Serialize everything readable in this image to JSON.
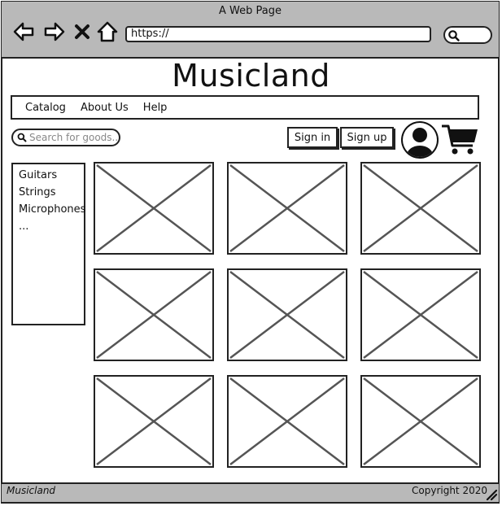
{
  "window": {
    "title": "A Web Page"
  },
  "browser": {
    "url": "https://"
  },
  "site": {
    "brand": "Musicland"
  },
  "menu": {
    "items": [
      "Catalog",
      "About Us",
      "Help"
    ]
  },
  "search": {
    "placeholder": "Search for goods..."
  },
  "auth": {
    "sign_in": "Sign in",
    "sign_up": "Sign up"
  },
  "icons": {
    "back": "back-arrow-icon",
    "forward": "forward-arrow-icon",
    "stop": "close-icon",
    "home": "home-icon",
    "search": "search-icon",
    "user": "user-avatar-icon",
    "cart": "cart-icon"
  },
  "categories": [
    "Guitars",
    "Strings",
    "Microphones",
    "..."
  ],
  "products": {
    "count": 9
  },
  "footer": {
    "left": "Musicland",
    "right": "Copyright 2020"
  },
  "colors": {
    "chrome": "#b9b9b9",
    "stroke": "#222222",
    "placeholder_x": "#555555"
  }
}
